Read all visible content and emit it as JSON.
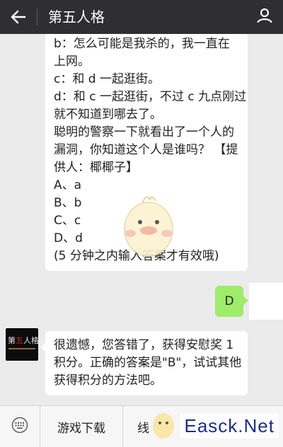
{
  "header": {
    "title": "第五人格",
    "back_icon": "arrow-left-icon",
    "profile_icon": "person-icon"
  },
  "messages": {
    "first": {
      "lines": [
        "b：怎么可能是我杀的，我一直在",
        "上网。",
        "c：和 d 一起逛街。",
        "d：和 c 一起逛街，不过 c 九点刚过",
        "就不知道到哪去了。",
        "聪明的警察一下就看出了一个人的",
        "漏洞，你知道这个人是谁吗？ 【提",
        "供人：椰椰子】",
        "A、a",
        "B、b",
        "C、c",
        "D、d",
        "(5 分钟之内输入答案才有效哦)"
      ]
    },
    "reply": "D",
    "second": {
      "lines": [
        "很遗憾，您答错了，获得安慰奖 1",
        "积分。正确的答案是\"B\"，试试其他",
        "获得积分的方法吧。"
      ]
    }
  },
  "bot_avatar": {
    "logo_left": "第",
    "logo_mid": "五",
    "logo_right": "人格"
  },
  "bottom_bar": {
    "keyboard_icon": "keyboard-icon",
    "menu1": "游戏下载",
    "menu2": "线"
  },
  "watermark": "Easck.Net",
  "colors": {
    "topbar": "#2e2e33",
    "chat_bg": "#ebebeb",
    "my_bubble": "#9feb6a",
    "watermark": "#1c2d8f"
  }
}
